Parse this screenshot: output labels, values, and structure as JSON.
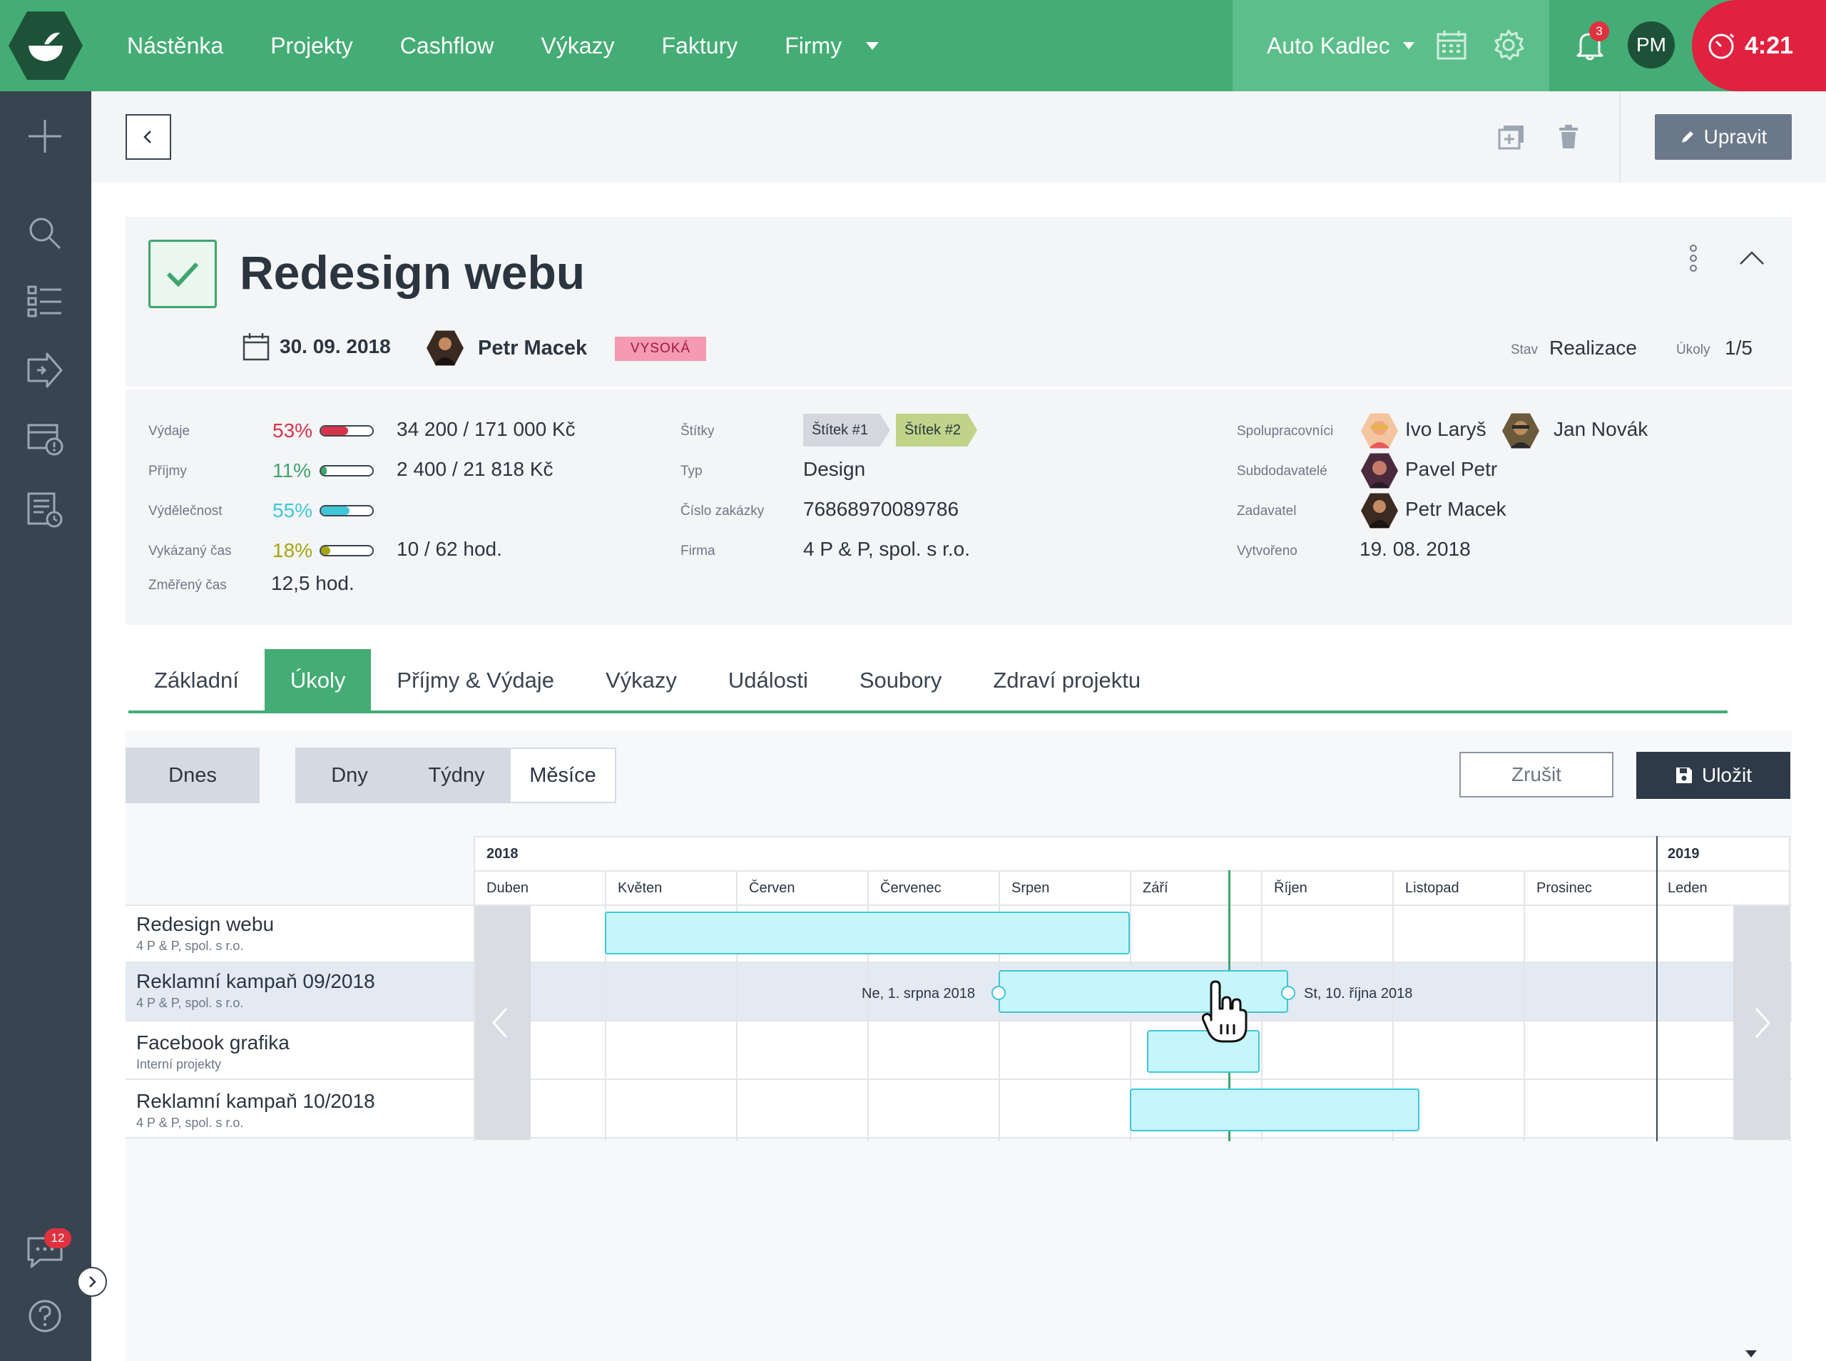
{
  "nav": {
    "items": [
      "Nástěnka",
      "Projekty",
      "Cashflow",
      "Výkazy",
      "Faktury",
      "Firmy"
    ],
    "company": "Auto Kadlec",
    "notifications": "3",
    "user_initials": "PM",
    "timer": "4:21"
  },
  "sidebar": {
    "chat_count": "12"
  },
  "toolbar": {
    "edit_label": "Upravit"
  },
  "project": {
    "title": "Redesign webu",
    "due_date": "30. 09. 2018",
    "owner": "Petr Macek",
    "priority": "VYSOKÁ",
    "status_label": "Stav",
    "status_value": "Realizace",
    "tasks_label": "Úkoly",
    "tasks_value": "1/5"
  },
  "details": {
    "expenses": {
      "label": "Výdaje",
      "pct": "53%",
      "fraction": 0.53,
      "value": "34 200 / 171 000 Kč",
      "color": "#d6344a"
    },
    "income": {
      "label": "Příjmy",
      "pct": "11%",
      "fraction": 0.11,
      "value": "2 400 / 21 818 Kč",
      "color": "#3fa56e"
    },
    "profitability": {
      "label": "Výdělečnost",
      "pct": "55%",
      "fraction": 0.55,
      "color": "#3fc6d6"
    },
    "reported_time": {
      "label": "Vykázaný čas",
      "pct": "18%",
      "fraction": 0.18,
      "value": "10 / 62 hod.",
      "color": "#a4a512"
    },
    "measured_time": {
      "label": "Změřený čas",
      "value": "12,5 hod."
    },
    "tags_label": "Štítky",
    "tags": [
      {
        "label": "Štítek #1",
        "color": "#d4d8de"
      },
      {
        "label": "Štítek #2",
        "color": "#bfd489"
      }
    ],
    "type_label": "Typ",
    "type_value": "Design",
    "order_label": "Číslo zakázky",
    "order_value": "76868970089786",
    "firm_label": "Firma",
    "firm_value": "4 P & P, spol. s r.o.",
    "collaborators_label": "Spolupracovníci",
    "collaborators": [
      "Ivo Laryš",
      "Jan Novák"
    ],
    "subcontractors_label": "Subdodavatelé",
    "subcontractor": "Pavel Petr",
    "client_label": "Zadavatel",
    "client": "Petr Macek",
    "created_label": "Vytvořeno",
    "created_value": "19. 08. 2018"
  },
  "tabs": [
    "Základní",
    "Úkoly",
    "Příjmy & Výdaje",
    "Výkazy",
    "Události",
    "Soubory",
    "Zdraví projektu"
  ],
  "active_tab": "Úkoly",
  "gantt": {
    "today_label": "Dnes",
    "scale": [
      "Dny",
      "Týdny",
      "Měsíce"
    ],
    "active_scale": "Měsíce",
    "cancel_label": "Zrušit",
    "save_label": "Uložit",
    "years": [
      "2018",
      "2019"
    ],
    "months": [
      "Duben",
      "Květen",
      "Červen",
      "Červenec",
      "Srpen",
      "Září",
      "Říjen",
      "Listopad",
      "Prosinec",
      "Leden"
    ],
    "rows": [
      {
        "name": "Redesign webu",
        "firm": "4 P & P, spol. s r.o."
      },
      {
        "name": "Reklamní kampaň 09/2018",
        "firm": "4 P & P, spol. s r.o."
      },
      {
        "name": "Facebook grafika",
        "firm": "Interní projekty"
      },
      {
        "name": "Reklamní kampaň 10/2018",
        "firm": "4 P & P, spol. s r.o."
      }
    ],
    "drag_start_label": "Ne, 1. srpna 2018",
    "drag_end_label": "St, 10. října 2018"
  },
  "colors": {
    "brand_green": "#44ac75",
    "sidebar": "#384450",
    "timer_red": "#e0213f",
    "bar_cyan": "#c6f6fa"
  }
}
